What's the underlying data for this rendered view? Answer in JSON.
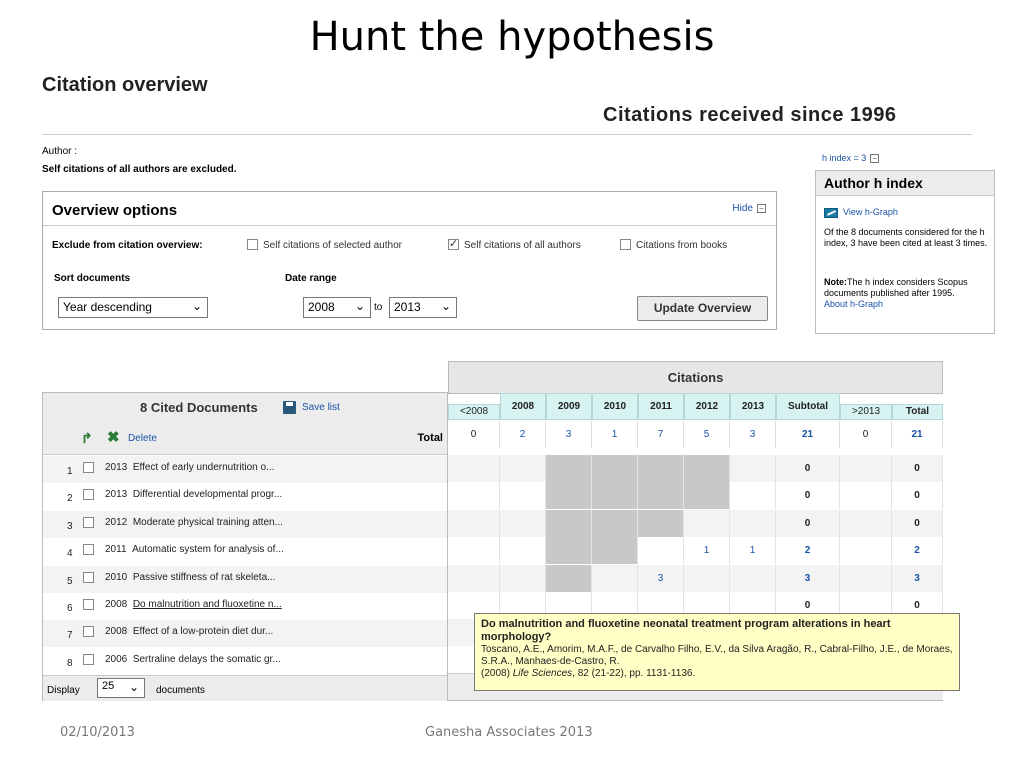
{
  "slide": {
    "title": "Hunt the hypothesis",
    "footer_date": "02/10/2013",
    "footer_org": "Ganesha Associates 2013"
  },
  "page": {
    "heading": "Citation overview",
    "subheading": "Citations received since 1996",
    "author_label": "Author :",
    "self_citations_note": "Self citations of all authors are excluded."
  },
  "hindex": {
    "value_label": "h index = 3",
    "panel_title": "Author h index",
    "view_graph": "View h-Graph",
    "description": "Of the 8 documents considered for the h index, 3 have been cited at least 3 times.",
    "note_label": "Note:",
    "note_text": "The h index considers Scopus documents published after 1995.",
    "about": "About h-Graph"
  },
  "overview": {
    "title": "Overview options",
    "hide": "Hide",
    "exclude_label": "Exclude from citation overview:",
    "options": [
      {
        "label": "Self citations of selected author",
        "checked": false
      },
      {
        "label": "Self citations of all authors",
        "checked": true
      },
      {
        "label": "Citations from books",
        "checked": false
      }
    ],
    "sort_label": "Sort documents",
    "sort_value": "Year descending",
    "date_label": "Date range",
    "date_from": "2008",
    "date_to": "2013",
    "to": "to",
    "update_button": "Update Overview"
  },
  "docs": {
    "title": "8 Cited Documents",
    "save_list": "Save list",
    "delete": "Delete",
    "total_label": "Total",
    "display_label": "Display",
    "display_value": "25",
    "documents_label": "documents",
    "rows": [
      {
        "num": "1",
        "year": "2013",
        "title": "Effect of early undernutrition o..."
      },
      {
        "num": "2",
        "year": "2013",
        "title": "Differential developmental progr..."
      },
      {
        "num": "3",
        "year": "2012",
        "title": "Moderate physical training atten..."
      },
      {
        "num": "4",
        "year": "2011",
        "title": "Automatic system for analysis of..."
      },
      {
        "num": "5",
        "year": "2010",
        "title": "Passive stiffness of rat skeleta..."
      },
      {
        "num": "6",
        "year": "2008",
        "title": "Do malnutrition and fluoxetine n..."
      },
      {
        "num": "7",
        "year": "2008",
        "title": "Effect of a low-protein diet dur..."
      },
      {
        "num": "8",
        "year": "2006",
        "title": "Sertraline delays the somatic gr..."
      }
    ]
  },
  "citations": {
    "header": "Citations",
    "columns": [
      "<2008",
      "2008",
      "2009",
      "2010",
      "2011",
      "2012",
      "2013",
      "Subtotal",
      ">2013",
      "Total"
    ],
    "totals": [
      "0",
      "2",
      "3",
      "1",
      "7",
      "5",
      "3",
      "21",
      "0",
      "21"
    ],
    "rows": [
      [
        "",
        "",
        "",
        "",
        "",
        "",
        "",
        "0",
        "",
        "0"
      ],
      [
        "",
        "",
        "",
        "",
        "",
        "",
        "",
        "0",
        "",
        "0"
      ],
      [
        "",
        "",
        "",
        "",
        "",
        "",
        "",
        "0",
        "",
        "0"
      ],
      [
        "",
        "",
        "",
        "",
        "",
        "1",
        "1",
        "2",
        "",
        "2"
      ],
      [
        "",
        "",
        "",
        "",
        "3",
        "",
        "",
        "3",
        "",
        "3"
      ],
      [
        "",
        "",
        "",
        "",
        "",
        "",
        "",
        "0",
        "",
        "0"
      ],
      [
        "",
        "",
        "",
        "",
        "",
        "",
        "",
        "",
        "",
        ""
      ],
      [
        "",
        "",
        "",
        "",
        "",
        "",
        "",
        "",
        "",
        ""
      ]
    ],
    "shaded": [
      [
        2,
        3,
        4,
        5
      ],
      [
        2,
        3,
        4,
        5
      ],
      [
        2,
        3,
        4
      ],
      [
        2,
        3
      ],
      [
        2
      ],
      [],
      [],
      []
    ]
  },
  "tooltip": {
    "title": "Do malnutrition and fluoxetine neonatal treatment program alterations in heart morphology?",
    "authors": "Toscano, A.E., Amorim, M.A.F., de Carvalho Filho, E.V., da Silva Aragão, R., Cabral-Filho, J.E., de Moraes, S.R.A., Manhaes-de-Castro, R.",
    "year": "(2008)",
    "journal": "Life Sciences",
    "details": ", 82 (21-22), pp. 1131-1136."
  }
}
